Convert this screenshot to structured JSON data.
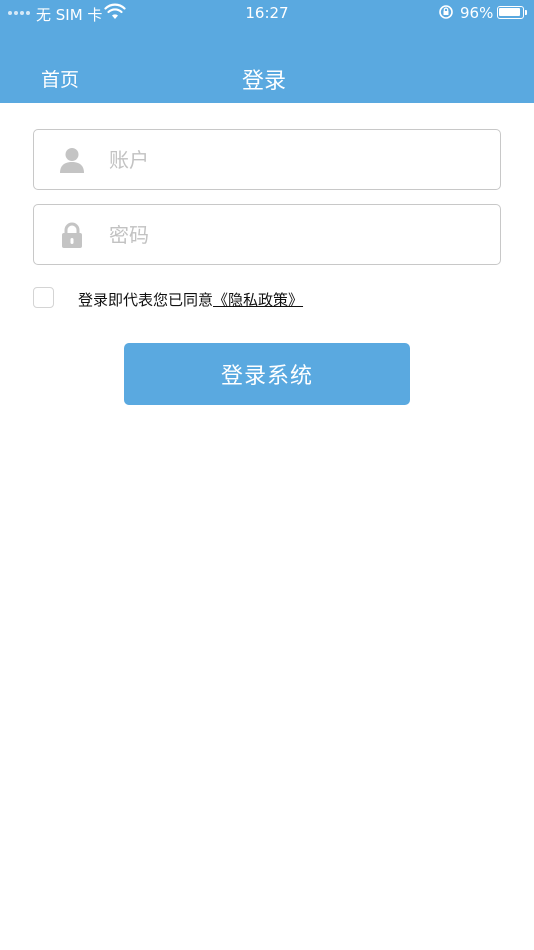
{
  "status_bar": {
    "carrier": "无 SIM 卡",
    "time": "16:27",
    "battery": "96%"
  },
  "nav": {
    "home_label": "首页",
    "title": "登录"
  },
  "form": {
    "account_placeholder": "账户",
    "password_placeholder": "密码",
    "agree_text": "登录即代表您已同意",
    "privacy_link": "《隐私政策》",
    "submit_label": "登录系统"
  },
  "colors": {
    "primary": "#5aa9e0",
    "placeholder": "#c2c2c2",
    "border": "#c8c8c8"
  },
  "icons": {
    "account": "user-icon",
    "password": "lock-icon"
  }
}
